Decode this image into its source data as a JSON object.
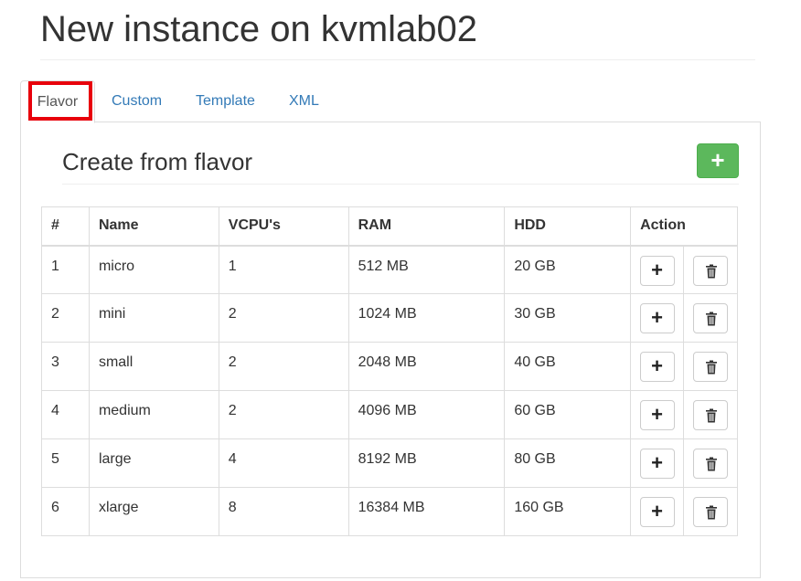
{
  "page": {
    "title": "New instance on kvmlab02"
  },
  "tabs": [
    {
      "label": "Flavor",
      "active": true
    },
    {
      "label": "Custom",
      "active": false
    },
    {
      "label": "Template",
      "active": false
    },
    {
      "label": "XML",
      "active": false
    }
  ],
  "section": {
    "title": "Create from flavor",
    "add_button_label": "+"
  },
  "table": {
    "headers": [
      "#",
      "Name",
      "VCPU's",
      "RAM",
      "HDD",
      "Action"
    ],
    "rows": [
      {
        "num": "1",
        "name": "micro",
        "vcpu": "1",
        "ram": "512 MB",
        "hdd": "20 GB"
      },
      {
        "num": "2",
        "name": "mini",
        "vcpu": "2",
        "ram": "1024 MB",
        "hdd": "30 GB"
      },
      {
        "num": "3",
        "name": "small",
        "vcpu": "2",
        "ram": "2048 MB",
        "hdd": "40 GB"
      },
      {
        "num": "4",
        "name": "medium",
        "vcpu": "2",
        "ram": "4096 MB",
        "hdd": "60 GB"
      },
      {
        "num": "5",
        "name": "large",
        "vcpu": "4",
        "ram": "8192 MB",
        "hdd": "80 GB"
      },
      {
        "num": "6",
        "name": "xlarge",
        "vcpu": "8",
        "ram": "16384 MB",
        "hdd": "160 GB"
      }
    ],
    "row_add_label": "+",
    "row_delete_icon": "trash-icon"
  },
  "colors": {
    "link": "#337ab7",
    "success": "#5cb85c",
    "highlight": "#e8000b"
  }
}
